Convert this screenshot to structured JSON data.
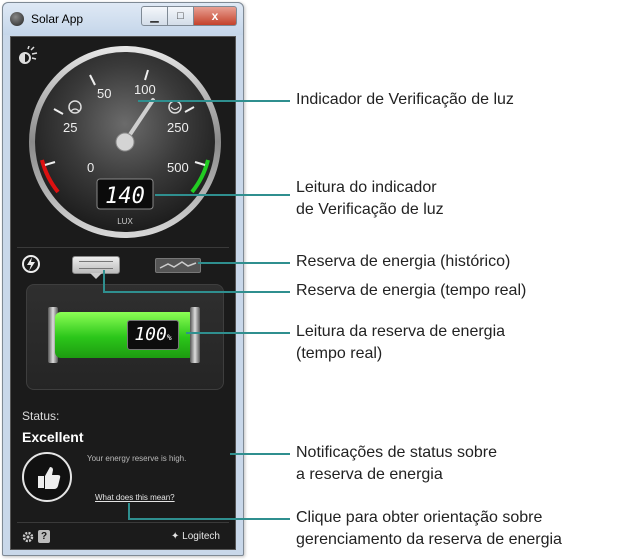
{
  "window": {
    "title": "Solar App",
    "buttons": {
      "minimize": "",
      "maximize": "",
      "close": "x"
    }
  },
  "gauge": {
    "ticks": [
      "0",
      "25",
      "50",
      "100",
      "250",
      "500"
    ],
    "reading": "140",
    "unit": "LUX"
  },
  "energy": {
    "reading": "100",
    "unit": "%"
  },
  "status": {
    "label": "Status:",
    "value": "Excellent",
    "notification": "Your energy reserve is high.",
    "link": "What does this mean?"
  },
  "brand": "Logitech",
  "help_label": "?",
  "annotations": {
    "light_indicator": "Indicador de Verificação de luz",
    "light_reading_1": "Leitura do indicador",
    "light_reading_2": "de Verificação de luz",
    "reserve_history": "Reserva de energia (histórico)",
    "reserve_realtime": "Reserva de energia (tempo real)",
    "reserve_reading_1": "Leitura da reserva de energia",
    "reserve_reading_2": "(tempo real)",
    "notif_1": "Notificações de status sobre",
    "notif_2": "a reserva de energia",
    "guide_1": "Clique para obter orientação sobre",
    "guide_2": "gerenciamento da reserva de energia"
  },
  "colors": {
    "accent_line": "#2f8f8f",
    "battery": "#2bc61a",
    "close": "#c4422b"
  }
}
